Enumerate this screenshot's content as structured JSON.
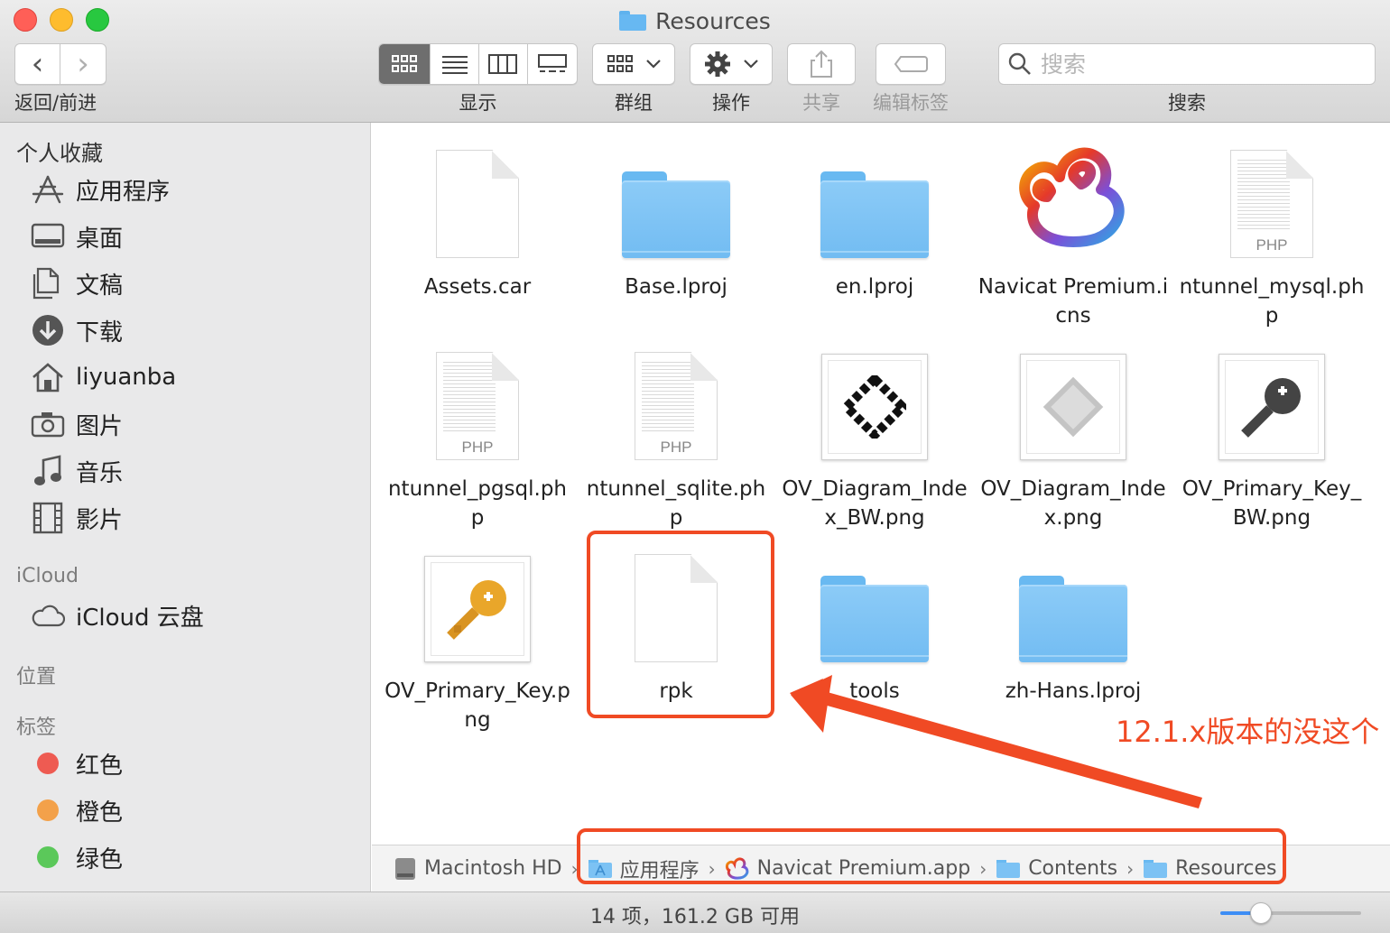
{
  "window": {
    "title": "Resources"
  },
  "toolbar": {
    "nav_label": "返回/前进",
    "view_label": "显示",
    "group_label": "群组",
    "action_label": "操作",
    "share_label": "共享",
    "tags_label": "编辑标签",
    "search_label": "搜索",
    "search_placeholder": "搜索",
    "active_view": "icon"
  },
  "sidebar": {
    "favorites_header": "个人收藏",
    "favorites": [
      {
        "label": "应用程序",
        "icon": "applications-icon"
      },
      {
        "label": "桌面",
        "icon": "desktop-icon"
      },
      {
        "label": "文稿",
        "icon": "documents-icon"
      },
      {
        "label": "下载",
        "icon": "downloads-icon"
      },
      {
        "label": "liyuanba",
        "icon": "home-icon"
      },
      {
        "label": "图片",
        "icon": "camera-icon"
      },
      {
        "label": "音乐",
        "icon": "music-note-icon"
      },
      {
        "label": "影片",
        "icon": "film-icon"
      }
    ],
    "icloud_header": "iCloud",
    "icloud_items": [
      {
        "label": "iCloud 云盘",
        "icon": "cloud-icon"
      }
    ],
    "locations_header": "位置",
    "tags_header": "标签",
    "tags": [
      {
        "label": "红色",
        "color": "#ee5b52"
      },
      {
        "label": "橙色",
        "color": "#f3a14a"
      },
      {
        "label": "绿色",
        "color": "#5bc85a"
      }
    ]
  },
  "files": [
    {
      "name": "Assets.car",
      "kind": "document"
    },
    {
      "name": "Base.lproj",
      "kind": "folder"
    },
    {
      "name": "en.lproj",
      "kind": "folder"
    },
    {
      "name": "Navicat Premium.icns",
      "kind": "app-icon"
    },
    {
      "name": "ntunnel_mysql.php",
      "kind": "php"
    },
    {
      "name": "ntunnel_pgsql.php",
      "kind": "php"
    },
    {
      "name": "ntunnel_sqlite.php",
      "kind": "php"
    },
    {
      "name": "OV_Diagram_Index_BW.png",
      "kind": "image-diagram-bw"
    },
    {
      "name": "OV_Diagram_Index.png",
      "kind": "image-diagram"
    },
    {
      "name": "OV_Primary_Key_BW.png",
      "kind": "image-key-bw"
    },
    {
      "name": "OV_Primary_Key.png",
      "kind": "image-key"
    },
    {
      "name": "rpk",
      "kind": "document"
    },
    {
      "name": "tools",
      "kind": "folder"
    },
    {
      "name": "zh-Hans.lproj",
      "kind": "folder"
    }
  ],
  "php_ext": "PHP",
  "annotation": {
    "text": "12.1.x版本的没这个",
    "color": "#f04a24",
    "highlighted_file": "rpk"
  },
  "pathbar": {
    "crumbs": [
      {
        "label": "Macintosh HD",
        "icon": "hard-drive-icon"
      },
      {
        "label": "应用程序",
        "icon": "applications-folder-icon"
      },
      {
        "label": "Navicat Premium.app",
        "icon": "navicat-icon"
      },
      {
        "label": "Contents",
        "icon": "folder-icon"
      },
      {
        "label": "Resources",
        "icon": "folder-icon"
      }
    ],
    "separator": "›"
  },
  "status": {
    "text": "14 项，161.2 GB 可用",
    "icon_size_level": 0.25
  }
}
